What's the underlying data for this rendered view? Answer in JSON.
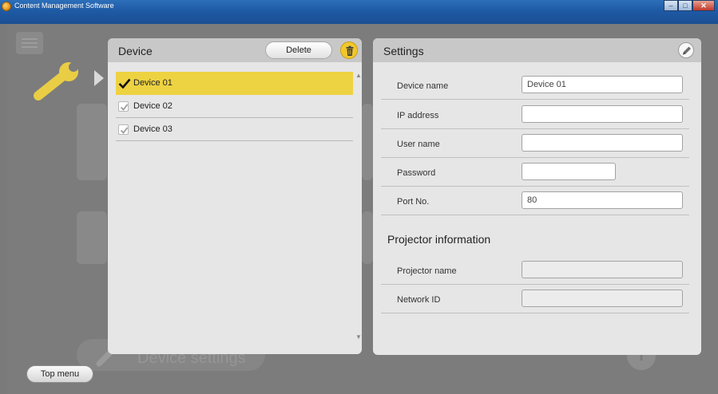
{
  "window": {
    "title": "Content Management Software"
  },
  "background": {
    "device_settings_label": "Device settings",
    "top_menu_label": "Top menu",
    "info_glyph": "i"
  },
  "device_panel": {
    "title": "Device",
    "delete_label": "Delete",
    "items": [
      {
        "label": "Device 01",
        "checked": true,
        "selected": true
      },
      {
        "label": "Device 02",
        "checked": true,
        "selected": false
      },
      {
        "label": "Device 03",
        "checked": true,
        "selected": false
      }
    ]
  },
  "settings_panel": {
    "title": "Settings",
    "fields": [
      {
        "label": "Device name",
        "value": "Device 01"
      },
      {
        "label": "IP address",
        "value": ""
      },
      {
        "label": "User name",
        "value": ""
      },
      {
        "label": "Password",
        "value": ""
      },
      {
        "label": "Port No.",
        "value": "80"
      }
    ],
    "projector_section_title": "Projector information",
    "projector_fields": [
      {
        "label": "Projector name",
        "value": ""
      },
      {
        "label": "Network ID",
        "value": ""
      }
    ]
  },
  "colors": {
    "accent_yellow": "#EDD242",
    "titlebar_blue": "#1E5AA5"
  },
  "icons": [
    "app-icon",
    "menu-icon",
    "wrench-icon",
    "arrow-right-icon",
    "trash-icon",
    "edit-icon",
    "checkmark-icon",
    "info-icon"
  ]
}
